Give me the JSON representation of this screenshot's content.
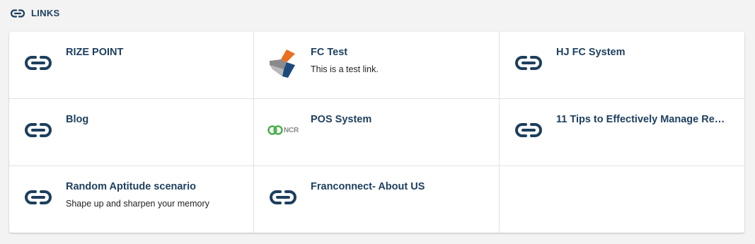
{
  "section": {
    "title": "LINKS",
    "icon": "link-icon"
  },
  "colors": {
    "primary": "#1d3f5e",
    "background": "#f3f3f3",
    "card": "#ffffff",
    "divider": "#e2e2e2"
  },
  "links": [
    {
      "title": "RIZE POINT",
      "description": "",
      "icon": "link-icon"
    },
    {
      "title": "FC Test",
      "description": "This is a test link.",
      "icon": "franconnect-logo"
    },
    {
      "title": "HJ FC System",
      "description": "",
      "icon": "link-icon"
    },
    {
      "title": "Blog",
      "description": "",
      "icon": "link-icon"
    },
    {
      "title": "POS System",
      "description": "",
      "icon": "ncr-logo",
      "logo_text": "NCR"
    },
    {
      "title": "11 Tips to Effectively Manage Rem…",
      "description": "",
      "icon": "link-icon"
    },
    {
      "title": "Random Aptitude scenario",
      "description": "Shape up and sharpen your memory",
      "icon": "link-icon"
    },
    {
      "title": "Franconnect- About US",
      "description": "",
      "icon": "link-icon"
    }
  ]
}
